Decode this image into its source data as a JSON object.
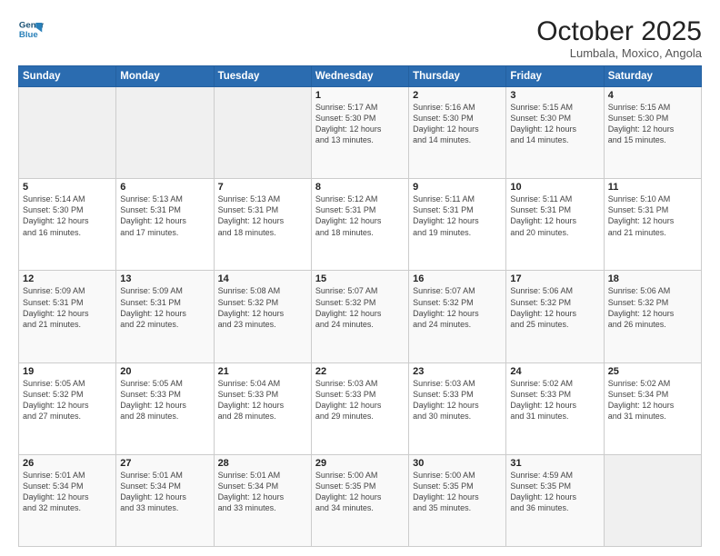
{
  "header": {
    "logo_line1": "General",
    "logo_line2": "Blue",
    "month": "October 2025",
    "location": "Lumbala, Moxico, Angola"
  },
  "weekdays": [
    "Sunday",
    "Monday",
    "Tuesday",
    "Wednesday",
    "Thursday",
    "Friday",
    "Saturday"
  ],
  "weeks": [
    [
      {
        "day": "",
        "info": ""
      },
      {
        "day": "",
        "info": ""
      },
      {
        "day": "",
        "info": ""
      },
      {
        "day": "1",
        "info": "Sunrise: 5:17 AM\nSunset: 5:30 PM\nDaylight: 12 hours\nand 13 minutes."
      },
      {
        "day": "2",
        "info": "Sunrise: 5:16 AM\nSunset: 5:30 PM\nDaylight: 12 hours\nand 14 minutes."
      },
      {
        "day": "3",
        "info": "Sunrise: 5:15 AM\nSunset: 5:30 PM\nDaylight: 12 hours\nand 14 minutes."
      },
      {
        "day": "4",
        "info": "Sunrise: 5:15 AM\nSunset: 5:30 PM\nDaylight: 12 hours\nand 15 minutes."
      }
    ],
    [
      {
        "day": "5",
        "info": "Sunrise: 5:14 AM\nSunset: 5:30 PM\nDaylight: 12 hours\nand 16 minutes."
      },
      {
        "day": "6",
        "info": "Sunrise: 5:13 AM\nSunset: 5:31 PM\nDaylight: 12 hours\nand 17 minutes."
      },
      {
        "day": "7",
        "info": "Sunrise: 5:13 AM\nSunset: 5:31 PM\nDaylight: 12 hours\nand 18 minutes."
      },
      {
        "day": "8",
        "info": "Sunrise: 5:12 AM\nSunset: 5:31 PM\nDaylight: 12 hours\nand 18 minutes."
      },
      {
        "day": "9",
        "info": "Sunrise: 5:11 AM\nSunset: 5:31 PM\nDaylight: 12 hours\nand 19 minutes."
      },
      {
        "day": "10",
        "info": "Sunrise: 5:11 AM\nSunset: 5:31 PM\nDaylight: 12 hours\nand 20 minutes."
      },
      {
        "day": "11",
        "info": "Sunrise: 5:10 AM\nSunset: 5:31 PM\nDaylight: 12 hours\nand 21 minutes."
      }
    ],
    [
      {
        "day": "12",
        "info": "Sunrise: 5:09 AM\nSunset: 5:31 PM\nDaylight: 12 hours\nand 21 minutes."
      },
      {
        "day": "13",
        "info": "Sunrise: 5:09 AM\nSunset: 5:31 PM\nDaylight: 12 hours\nand 22 minutes."
      },
      {
        "day": "14",
        "info": "Sunrise: 5:08 AM\nSunset: 5:32 PM\nDaylight: 12 hours\nand 23 minutes."
      },
      {
        "day": "15",
        "info": "Sunrise: 5:07 AM\nSunset: 5:32 PM\nDaylight: 12 hours\nand 24 minutes."
      },
      {
        "day": "16",
        "info": "Sunrise: 5:07 AM\nSunset: 5:32 PM\nDaylight: 12 hours\nand 24 minutes."
      },
      {
        "day": "17",
        "info": "Sunrise: 5:06 AM\nSunset: 5:32 PM\nDaylight: 12 hours\nand 25 minutes."
      },
      {
        "day": "18",
        "info": "Sunrise: 5:06 AM\nSunset: 5:32 PM\nDaylight: 12 hours\nand 26 minutes."
      }
    ],
    [
      {
        "day": "19",
        "info": "Sunrise: 5:05 AM\nSunset: 5:32 PM\nDaylight: 12 hours\nand 27 minutes."
      },
      {
        "day": "20",
        "info": "Sunrise: 5:05 AM\nSunset: 5:33 PM\nDaylight: 12 hours\nand 28 minutes."
      },
      {
        "day": "21",
        "info": "Sunrise: 5:04 AM\nSunset: 5:33 PM\nDaylight: 12 hours\nand 28 minutes."
      },
      {
        "day": "22",
        "info": "Sunrise: 5:03 AM\nSunset: 5:33 PM\nDaylight: 12 hours\nand 29 minutes."
      },
      {
        "day": "23",
        "info": "Sunrise: 5:03 AM\nSunset: 5:33 PM\nDaylight: 12 hours\nand 30 minutes."
      },
      {
        "day": "24",
        "info": "Sunrise: 5:02 AM\nSunset: 5:33 PM\nDaylight: 12 hours\nand 31 minutes."
      },
      {
        "day": "25",
        "info": "Sunrise: 5:02 AM\nSunset: 5:34 PM\nDaylight: 12 hours\nand 31 minutes."
      }
    ],
    [
      {
        "day": "26",
        "info": "Sunrise: 5:01 AM\nSunset: 5:34 PM\nDaylight: 12 hours\nand 32 minutes."
      },
      {
        "day": "27",
        "info": "Sunrise: 5:01 AM\nSunset: 5:34 PM\nDaylight: 12 hours\nand 33 minutes."
      },
      {
        "day": "28",
        "info": "Sunrise: 5:01 AM\nSunset: 5:34 PM\nDaylight: 12 hours\nand 33 minutes."
      },
      {
        "day": "29",
        "info": "Sunrise: 5:00 AM\nSunset: 5:35 PM\nDaylight: 12 hours\nand 34 minutes."
      },
      {
        "day": "30",
        "info": "Sunrise: 5:00 AM\nSunset: 5:35 PM\nDaylight: 12 hours\nand 35 minutes."
      },
      {
        "day": "31",
        "info": "Sunrise: 4:59 AM\nSunset: 5:35 PM\nDaylight: 12 hours\nand 36 minutes."
      },
      {
        "day": "",
        "info": ""
      }
    ]
  ]
}
